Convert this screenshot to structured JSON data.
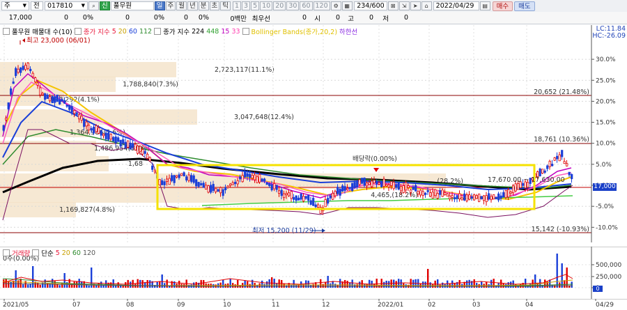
{
  "toolbar1": {
    "market": "주",
    "period": "전",
    "code": "017810",
    "badge_new": "신",
    "name": "풀무원",
    "button_il": "일",
    "period_buttons": [
      "주",
      "월",
      "년",
      "분",
      "초",
      "틱"
    ],
    "minute_buttons": [
      "1",
      "3",
      "5",
      "10",
      "20",
      "30",
      "60",
      "120"
    ],
    "count": "234/600",
    "date": "2022/04/29",
    "buy_label": "매수",
    "sell_label": "매도"
  },
  "toolbar2": {
    "price": "17,000",
    "change": "0",
    "change_rate": "0%",
    "v1": "0",
    "v2": "0%",
    "v3": "0",
    "v4": "0%",
    "volume_money": "0백만",
    "priority_label": "최우선",
    "v5": "0",
    "open_label": "시",
    "open_val": "0",
    "high_label": "고",
    "high_val": "0",
    "low_label": "저",
    "low_val": "0"
  },
  "legend_main": {
    "title": "풀무원 매물대 수(10)",
    "ma_label": "종가 지수",
    "ma_periods": [
      "5",
      "20",
      "60",
      "112"
    ],
    "ma2_label": "종가 지수",
    "ma2_periods": [
      "224",
      "448",
      "15",
      "33"
    ],
    "bb_label": "Bollinger Bands(종가,20,2)",
    "bb_extra": "하한선",
    "colors": {
      "ma5": "#e8173a",
      "ma20": "#f5c400",
      "ma60": "#1a3fd8",
      "ma112": "#2e8b2e",
      "ma224": "#000000",
      "ma448": "#44cc44",
      "ma15": "#c000c0",
      "ma33": "#ff5fc0",
      "bb": "#e0c000"
    }
  },
  "legend_vol": {
    "title": "거래량",
    "ma_label": "단순",
    "periods": [
      "5",
      "20",
      "60",
      "120"
    ]
  },
  "info": {
    "lc": "LC:11.84",
    "hc": "HC:-26.09"
  },
  "annotations": {
    "high": "최고 23,000 (06/01)",
    "low": "최저 15,200 (11/29)",
    "dividend": "배당락(0.00%)",
    "line_upper": "20,652 (21.48%)",
    "line_mid": "18,761 (10.36%)",
    "line_lower": "15,142 (-10.93%)",
    "range_text": "17,670.00 ~ 17,630.00",
    "vol_zero": "0주(0.00%)"
  },
  "volume_profile": [
    {
      "label": "2,723,117(11.1%)",
      "value": 2723117
    },
    {
      "label": "1,788,840(7.3%)",
      "value": 1788840
    },
    {
      "label": "996,292(4.1%)",
      "value": 996292
    },
    {
      "label": "3,047,648(12.4%)",
      "value": 3047648
    },
    {
      "label": "1,364,986(5.6%)",
      "value": 1364986
    },
    {
      "label": "1,486,954(6.1%)",
      "value": 1486954
    },
    {
      "label": "1,68",
      "value": 1680000
    },
    {
      "label": "(28.2%)",
      "value": 6900000
    },
    {
      "label": "4,465,(18.2%)",
      "value": 4465000
    },
    {
      "label": "1,169,827(4.8%)",
      "value": 1169827
    }
  ],
  "y_axis_pct": [
    "30.0%",
    "25.0%",
    "20.0%",
    "15.0%",
    "10.0%",
    "5.0%",
    "0.0%",
    "-5.0%",
    "-10.0%"
  ],
  "y_axis_vol": [
    "500,000",
    "250,000",
    "0"
  ],
  "price_tag": "17,000",
  "vol_tag": "0",
  "x_axis": [
    "2021/05",
    "07",
    "08",
    "09",
    "10",
    "11",
    "12",
    "2022/01",
    "02",
    "03",
    "04",
    "04/29"
  ],
  "chart_data": {
    "type": "line",
    "title": "풀무원",
    "x": [
      "2021/05",
      "07",
      "08",
      "09",
      "10",
      "11",
      "12",
      "2022/01",
      "02",
      "03",
      "04",
      "04/29"
    ],
    "series": [
      {
        "name": "종가",
        "values": [
          20000,
          21000,
          18500,
          17800,
          17300,
          16500,
          16000,
          16800,
          16600,
          16300,
          17200,
          17000
        ]
      }
    ],
    "ylim": [
      -12,
      33
    ]
  }
}
